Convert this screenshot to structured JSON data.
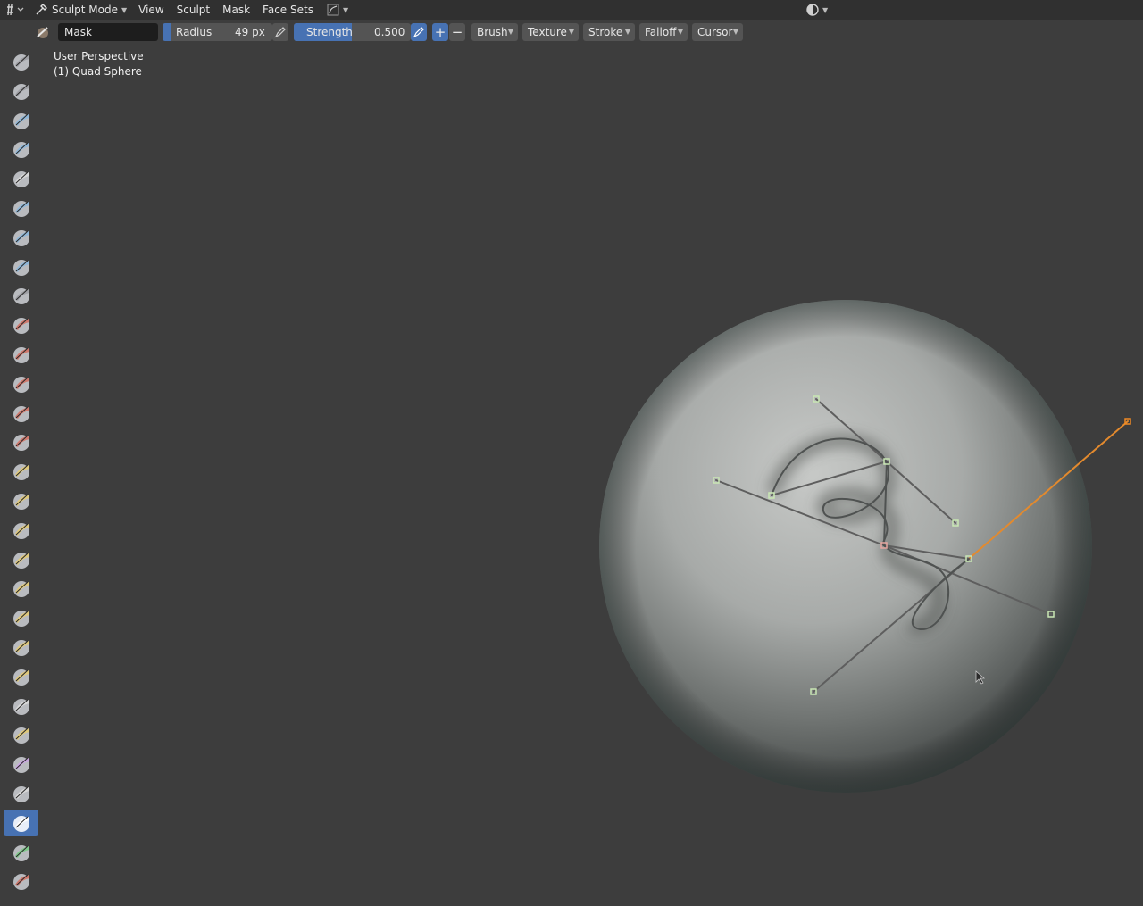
{
  "header": {
    "mode": {
      "label": "Sculpt Mode"
    },
    "menus": [
      {
        "id": "view",
        "label": "View"
      },
      {
        "id": "sculpt",
        "label": "Sculpt"
      },
      {
        "id": "mask",
        "label": "Mask"
      },
      {
        "id": "face_sets",
        "label": "Face Sets"
      }
    ]
  },
  "tool_settings": {
    "brush_name": "Mask",
    "radius": {
      "label": "Radius",
      "value": "49 px"
    },
    "strength": {
      "label": "Strength",
      "value": "0.500",
      "fraction": 0.5
    },
    "dropdowns": [
      {
        "id": "brush",
        "label": "Brush"
      },
      {
        "id": "texture",
        "label": "Texture"
      },
      {
        "id": "stroke",
        "label": "Stroke"
      },
      {
        "id": "falloff",
        "label": "Falloff"
      },
      {
        "id": "cursor",
        "label": "Cursor"
      }
    ],
    "add_symbol": "+",
    "subtract_symbol": "−"
  },
  "viewport": {
    "view_name": "User Perspective",
    "object_name": "(1) Quad Sphere"
  },
  "tools": [
    {
      "name": "draw-brush",
      "color": "#9fa0a5"
    },
    {
      "name": "draw-sharp-brush",
      "color": "#9fa0a5"
    },
    {
      "name": "clay-brush",
      "color": "#8fb7d9"
    },
    {
      "name": "clay-strips-brush",
      "color": "#8fb7d9"
    },
    {
      "name": "clay-thumb-brush",
      "color": "#d8d8d8"
    },
    {
      "name": "layer-brush",
      "color": "#8fb7d9"
    },
    {
      "name": "inflate-brush",
      "color": "#8fb7d9"
    },
    {
      "name": "blob-brush",
      "color": "#8fb7d9"
    },
    {
      "name": "crease-brush",
      "color": "#9fa0a5"
    },
    {
      "name": "smooth-brush",
      "color": "#d0786c"
    },
    {
      "name": "flatten-brush",
      "color": "#d0786c"
    },
    {
      "name": "fill-brush",
      "color": "#d0786c"
    },
    {
      "name": "scrape-brush",
      "color": "#d0786c"
    },
    {
      "name": "multiplane-scrape-brush",
      "color": "#d0786c"
    },
    {
      "name": "pinch-brush",
      "color": "#e0c97a"
    },
    {
      "name": "grab-brush",
      "color": "#e0c97a"
    },
    {
      "name": "elastic-deform-brush",
      "color": "#e0c97a"
    },
    {
      "name": "snake-hook-brush",
      "color": "#e0c97a"
    },
    {
      "name": "thumb-brush",
      "color": "#e0c97a"
    },
    {
      "name": "pose-brush",
      "color": "#e0c97a"
    },
    {
      "name": "nudge-brush",
      "color": "#e0c97a"
    },
    {
      "name": "rotate-brush",
      "color": "#e0c97a"
    },
    {
      "name": "slide-relax-brush",
      "color": "#d8d8d8"
    },
    {
      "name": "boundary-brush",
      "color": "#e0c97a"
    },
    {
      "name": "cloth-brush",
      "color": "#c9a7e0"
    },
    {
      "name": "simplify-brush",
      "color": "#d8d8d8"
    },
    {
      "name": "mask-brush",
      "color": "#ffffff"
    },
    {
      "name": "draw-face-sets-brush",
      "color": "#7fc98a"
    },
    {
      "name": "multires-displacement-eraser-brush",
      "color": "#d0786c"
    }
  ],
  "active_tool": "mask-brush",
  "colors": {
    "accent": "#4772b3",
    "viewport_bg": "#3d3d3d",
    "header_bg": "#303030",
    "curve_handle": "#c9e7b4",
    "active_handle": "#f08a24"
  }
}
